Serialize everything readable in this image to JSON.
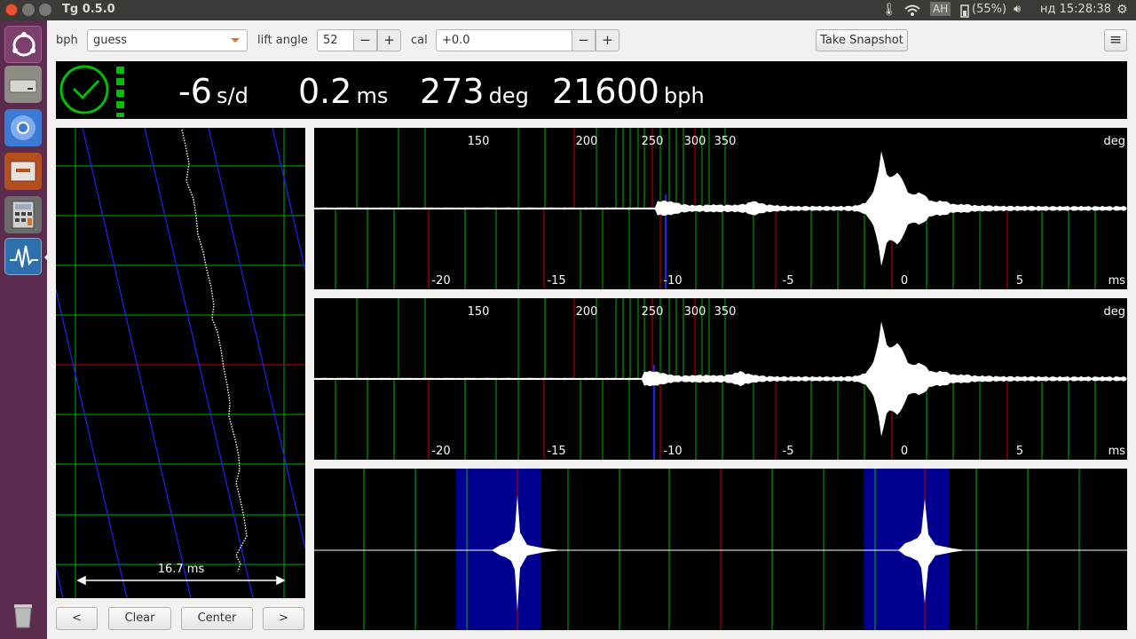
{
  "window": {
    "title": "Tg 0.5.0"
  },
  "system_tray": {
    "keyboard_layout": "АН",
    "battery": "(55%)",
    "clock": "нд 15:28:38"
  },
  "launcher": {
    "items": [
      "ubuntu-dash-icon",
      "disk-drive-icon",
      "chromium-icon",
      "files-icon",
      "calculator-icon",
      "tg-timegrapher-icon",
      "trash-icon"
    ]
  },
  "toolbar": {
    "bph_label": "bph",
    "bph_value": "guess",
    "lift_label": "lift angle",
    "lift_value": "52",
    "cal_label": "cal",
    "cal_value": "+0.0",
    "minus": "−",
    "plus": "+",
    "snapshot": "Take Snapshot",
    "menu_icon": "≡"
  },
  "readout": {
    "rate": "-6",
    "rate_unit": "s/d",
    "beat_error": "0.2",
    "beat_error_unit": "ms",
    "amplitude": "273",
    "amplitude_unit": "deg",
    "bph": "21600",
    "bph_unit": "bph",
    "status_color": "#00c000"
  },
  "paper_strip": {
    "span_label": "16.7 ms",
    "buttons": {
      "left": "<",
      "clear": "Clear",
      "center": "Center",
      "right": ">"
    }
  },
  "waveforms": {
    "deg_ticks": [
      "150",
      "200",
      "250",
      "300",
      "350"
    ],
    "deg_unit": "deg",
    "ms_ticks": [
      "-20",
      "-15",
      "-10",
      "-5",
      "0",
      "5"
    ],
    "ms_unit": "ms"
  },
  "colors": {
    "grid_green": "#00b000",
    "grid_red": "#d00000",
    "marker_blue": "#2020ff",
    "highlight_blue": "#000090"
  }
}
